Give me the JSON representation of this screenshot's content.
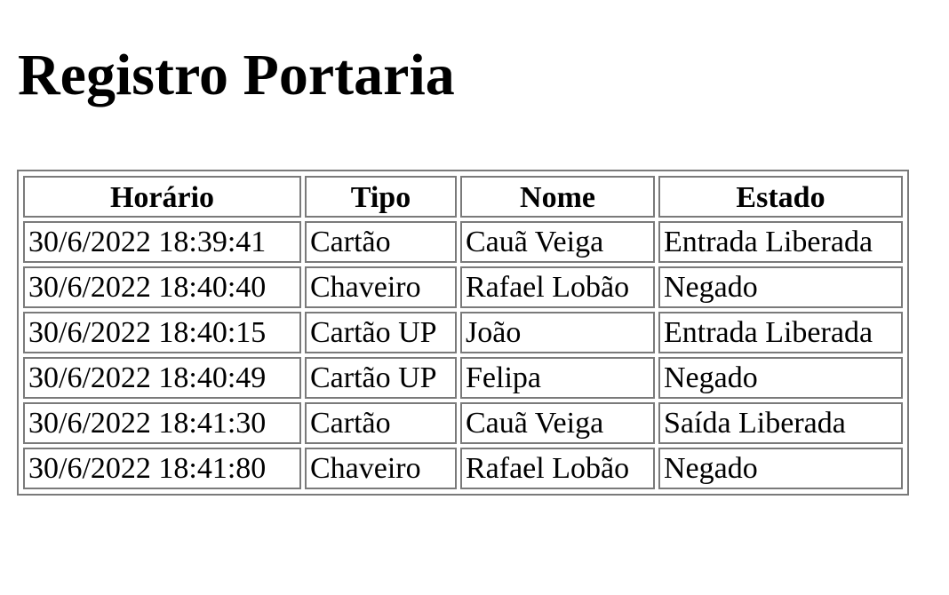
{
  "page": {
    "title": "Registro Portaria"
  },
  "table": {
    "headers": [
      "Horário",
      "Tipo",
      "Nome",
      "Estado"
    ],
    "rows": [
      [
        "30/6/2022 18:39:41",
        "Cartão",
        "Cauã Veiga",
        "Entrada Liberada"
      ],
      [
        "30/6/2022 18:40:40",
        "Chaveiro",
        "Rafael Lobão",
        "Negado"
      ],
      [
        "30/6/2022 18:40:15",
        "Cartão UP",
        "João",
        "Entrada Liberada"
      ],
      [
        "30/6/2022 18:40:49",
        "Cartão UP",
        "Felipa",
        "Negado"
      ],
      [
        "30/6/2022 18:41:30",
        "Cartão",
        "Cauã Veiga",
        "Saída Liberada"
      ],
      [
        "30/6/2022 18:41:80",
        "Chaveiro",
        "Rafael Lobão",
        "Negado"
      ]
    ]
  },
  "colors": {
    "border": "#7a7a7a",
    "text": "#000000",
    "background": "#ffffff"
  }
}
